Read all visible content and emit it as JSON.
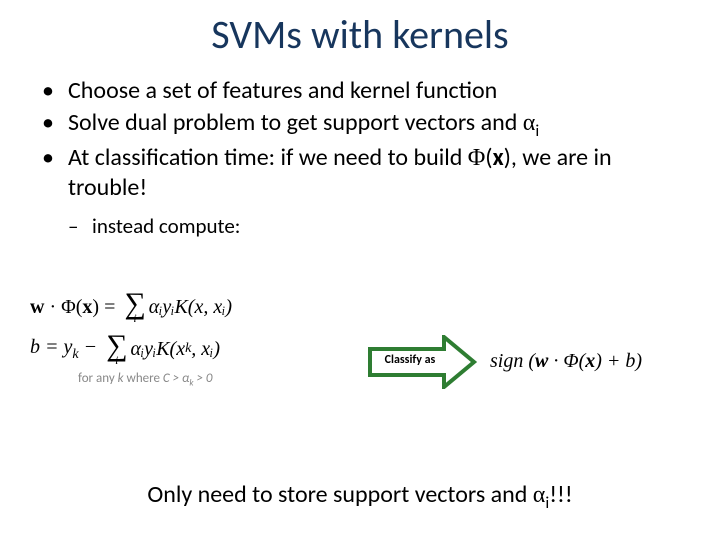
{
  "title": "SVMs with kernels",
  "bullets": {
    "b1": "Choose a set of features and kernel function",
    "b2_pre": "Solve dual problem to get support vectors and ",
    "b2_sym": "α",
    "b2_sub": "i",
    "b3_pre": "At classification time: if we need to build ",
    "b3_phi": "Φ",
    "b3_x": "x",
    "b3_post": "), we are in trouble!",
    "sub1": "instead compute:"
  },
  "math": {
    "eq1_lhs_w": "w",
    "eq1_lhs_dot": " · ",
    "eq1_lhs_phi": "Φ",
    "eq1_lhs_x": "x",
    "eq1_eq": " = ",
    "sigma_idx": "i",
    "eq1_term": "αᵢyᵢK(x, xᵢ)",
    "eq2_lhs": "b = y",
    "eq2_lhs_sub": "k",
    "eq2_minus": " − ",
    "eq2_term": "αᵢyᵢK(x",
    "eq2_term_sub": "k",
    "eq2_term_end": ", xᵢ)",
    "cond_pre": "for any ",
    "cond_k": "k",
    "cond_mid": " where ",
    "cond_expr": "C > α",
    "cond_sub": "k",
    "cond_end": " > 0"
  },
  "arrow_label": "Classify as",
  "result": {
    "sign": "sign",
    "open": " (",
    "w": "w",
    "dot": " · ",
    "phi": "Φ",
    "x": "x",
    "plus": ") + ",
    "b": "b",
    "close": ")"
  },
  "footer": {
    "pre": "Only need to store support vectors and ",
    "sym": "α",
    "sub": "i",
    "post": "!!!"
  }
}
